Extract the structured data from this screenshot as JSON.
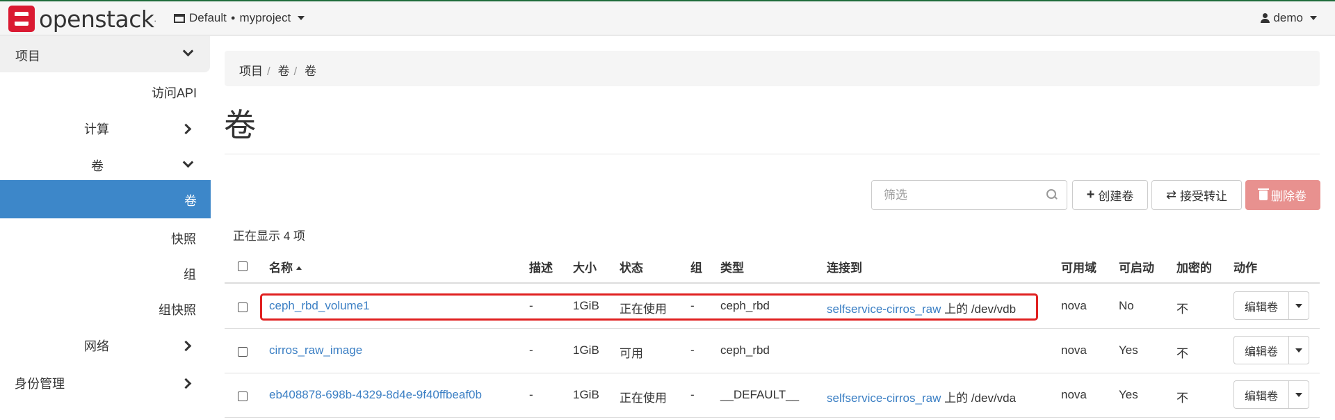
{
  "topbar": {
    "logo_text": "openstack",
    "domain": "Default",
    "project": "myproject",
    "user": "demo"
  },
  "sidebar": {
    "project": "项目",
    "access_api": "访问API",
    "compute": "计算",
    "volumes_group": "卷",
    "volumes": "卷",
    "snapshots": "快照",
    "groups": "组",
    "group_snapshots": "组快照",
    "network": "网络",
    "identity": "身份管理"
  },
  "breadcrumb": [
    "项目",
    "卷",
    "卷"
  ],
  "page_title": "卷",
  "toolbar": {
    "filter_placeholder": "筛选",
    "create_label": "创建卷",
    "accept_label": "接受转让",
    "delete_label": "删除卷"
  },
  "count_text": "正在显示 4 项",
  "table": {
    "headers": [
      "名称",
      "描述",
      "大小",
      "状态",
      "组",
      "类型",
      "连接到",
      "可用域",
      "可启动",
      "加密的",
      "动作"
    ],
    "rows": [
      {
        "name": "ceph_rbd_volume1",
        "desc": "-",
        "size": "1GiB",
        "status": "正在使用",
        "group": "-",
        "type": "ceph_rbd",
        "attach_link": "selfservice-cirros_raw",
        "attach_rest": " 上的 /dev/vdb",
        "zone": "nova",
        "bootable": "No",
        "encrypted": "不",
        "action": "编辑卷"
      },
      {
        "name": "cirros_raw_image",
        "desc": "-",
        "size": "1GiB",
        "status": "可用",
        "group": "-",
        "type": "ceph_rbd",
        "attach_link": "",
        "attach_rest": "",
        "zone": "nova",
        "bootable": "Yes",
        "encrypted": "不",
        "action": "编辑卷"
      },
      {
        "name": "eb408878-698b-4329-8d4e-9f40ffbeaf0b",
        "desc": "-",
        "size": "1GiB",
        "status": "正在使用",
        "group": "-",
        "type": "__DEFAULT__",
        "attach_link": "selfservice-cirros_raw",
        "attach_rest": " 上的 /dev/vda",
        "zone": "nova",
        "bootable": "Yes",
        "encrypted": "不",
        "action": "编辑卷"
      }
    ]
  },
  "colors": {
    "accent": "#3d87c9",
    "link": "#3b7fc4",
    "danger": "#e8918f",
    "highlight": "#e02020",
    "logo": "#da1a32"
  }
}
